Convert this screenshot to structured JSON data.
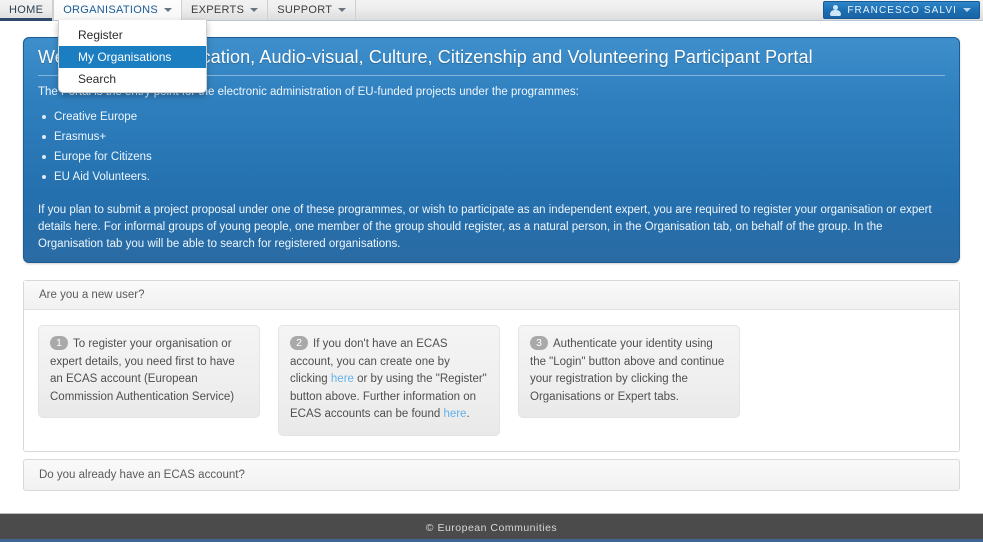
{
  "navbar": {
    "items": [
      {
        "label": "HOME",
        "has_caret": false,
        "active": true
      },
      {
        "label": "ORGANISATIONS",
        "has_caret": true,
        "open": true
      },
      {
        "label": "EXPERTS",
        "has_caret": true
      },
      {
        "label": "SUPPORT",
        "has_caret": true
      }
    ],
    "user": {
      "name": "FRANCESCO SALVI",
      "icon": "user-icon",
      "caret": "chevron-down-icon"
    }
  },
  "dropdown": {
    "parent": "ORGANISATIONS",
    "items": [
      {
        "label": "Register",
        "highlighted": false
      },
      {
        "label": "My Organisations",
        "highlighted": true
      },
      {
        "label": "Search",
        "highlighted": false
      }
    ]
  },
  "hero": {
    "title": "Welcome to the Education, Audio-visual, Culture, Citizenship and Volunteering Participant Portal",
    "intro": "The Portal is the entry point for the electronic administration of EU-funded projects under the programmes:",
    "programmes": [
      "Creative Europe",
      "Erasmus+",
      "Europe for Citizens",
      "EU Aid Volunteers."
    ],
    "body": "If you plan to submit a project proposal under one of these programmes, or wish to participate as an independent expert, you are required to register your organisation or expert details here. For informal groups of young people, one member of the group should register, as a natural person, in the Organisation tab, on behalf of the group. In the Organisation tab you will be able to search for registered organisations."
  },
  "new_user": {
    "header": "Are you a new user?",
    "steps": [
      {
        "number": "1",
        "text": "To register your organisation or expert details, you need first to have an ECAS account (European Commission Authentication Service)"
      },
      {
        "number": "2",
        "text_part1": "If you don't have an ECAS account, you can create one by clicking ",
        "link1": "here",
        "text_part2": " or by using the \"Register\" button above. Further information on ECAS accounts can be found ",
        "link2": "here",
        "text_part3": "."
      },
      {
        "number": "3",
        "text": "Authenticate your identity using the \"Login\" button above and continue your registration by clicking the Organisations or Expert tabs."
      }
    ]
  },
  "ecas_bar": {
    "label": "Do you already have an ECAS account?"
  },
  "footer": {
    "text": "© European Communities"
  },
  "colors": {
    "hero_blue": "#2f7fbe",
    "accent_blue": "#1b7ec1",
    "link_blue": "#64b2e8",
    "footer_gray": "#4b4b4b",
    "footer_accent": "#3f6792"
  }
}
